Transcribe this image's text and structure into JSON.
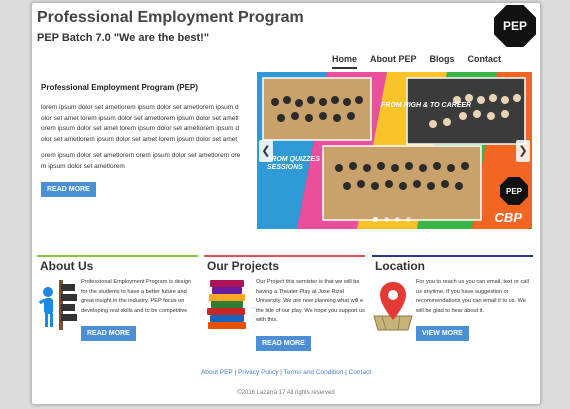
{
  "header": {
    "title": "Professional Employment Program",
    "tagline": "PEP Batch 7.0 \"We are the best!\"",
    "logo_text": "PEP"
  },
  "nav": {
    "items": [
      {
        "label": "Home",
        "active": true
      },
      {
        "label": "About PEP"
      },
      {
        "label": "Blogs"
      },
      {
        "label": "Contact"
      }
    ]
  },
  "intro": {
    "heading": "Professional Employment Program (PEP)",
    "paragraph1": "lorem ipsum dolor set ametlorem ipsum dolor set ametlorem ipsum dolor set amet lorem ipsum dolor set ametlorem ipsum dolor set ametlorem ipsum dolor set amet lorem ipsum dolor set ametlorem ipsum dolor set ametlorem ipsum dolor set amet lorem ipsum dolor set amet",
    "paragraph2": "orem ipsum dolor set ametlorem orem ipsum dolor set ametlorem orem ipsum dolor set ametlorem",
    "button": "READ MORE"
  },
  "slider": {
    "caption_top": "FROM HIGH & TO CAREER",
    "caption_left": "FROM QUIZZES SESSIONS",
    "badge": "PEP",
    "watermark": "CBP",
    "dots": 4,
    "active_dot": 0
  },
  "columns": {
    "about": {
      "title": "About Us",
      "accent": "#8cc63f",
      "text": "Professional Employment Program is design for the students to have a better future and great insight in the industry. PEP focus on developing real skills and to be competitive",
      "button": "READ MORE"
    },
    "projects": {
      "title": "Our Projects",
      "accent": "#d9534f",
      "text": "Our Project this semister is that we will be having a Theater Play at Jose Rizal University. We are now planning what will e the title of our play. We hope you support us with this.",
      "button": "READ MORE"
    },
    "location": {
      "title": "Location",
      "accent": "#1f3a93",
      "text": "For you to reach us you can email, text or call us anytime. If you have suggestion or recommendations you can email it to us. We will be glad to hear about it.",
      "button": "VIEW MORE"
    }
  },
  "footer": {
    "links": [
      "About PEP",
      "Privacy Policy",
      "Terms and Condition",
      "Contact"
    ],
    "separator": "|",
    "copyright": "©2016 Lazarra 17 All rights reserved"
  }
}
